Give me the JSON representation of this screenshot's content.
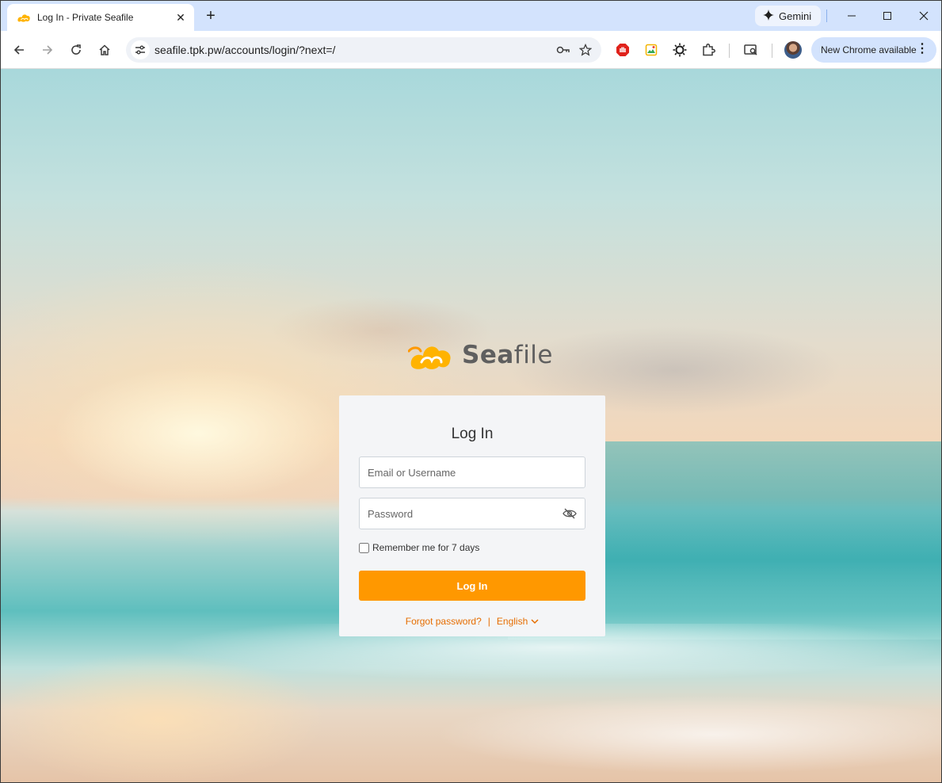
{
  "browser": {
    "tab": {
      "title": "Log In - Private Seafile",
      "close": "✕"
    },
    "new_tab": "+",
    "gemini_label": "Gemini",
    "url": "seafile.tpk.pw/accounts/login/?next=/",
    "update_label": "New Chrome available"
  },
  "page": {
    "logo": {
      "word_strong": "Sea",
      "word_light": "file",
      "color": "#ff9800"
    },
    "login_title": "Log In",
    "email_placeholder": "Email or Username",
    "password_placeholder": "Password",
    "remember_label": "Remember me for 7 days",
    "login_button": "Log In",
    "forgot_password": "Forgot password?",
    "separator": "|",
    "language": "English",
    "accent_color": "#ff9800",
    "link_color": "#e66d00"
  }
}
